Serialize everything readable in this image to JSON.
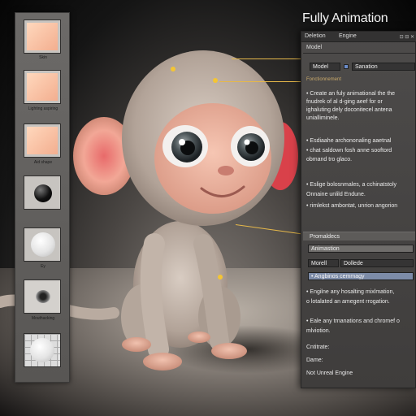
{
  "title": "Fully Animation",
  "left_strip": {
    "swatches": [
      {
        "kind": "skin",
        "caption": "Skin"
      },
      {
        "kind": "skin",
        "caption": "Lighting aspiring"
      },
      {
        "kind": "skin",
        "caption": "Aid shape"
      },
      {
        "kind": "black-ball",
        "caption": ""
      },
      {
        "kind": "white-ball",
        "caption": "Ey"
      },
      {
        "kind": "eye",
        "caption": "Mouthacking"
      },
      {
        "kind": "grid-ball",
        "caption": ""
      }
    ]
  },
  "panel": {
    "tabs": [
      "Deletion",
      "Engine"
    ],
    "model_label": "Model",
    "field1": "Model",
    "field2": "Sanation",
    "section_header": "Fonctionnement",
    "bullets": [
      "• Create an fuly animational the the",
      "  fnudrek of al d-ging aeef for or",
      "  ighaluting dely doconitecel antena",
      "  unialliminele.",
      "• Esdiaahe archononaling aaetnal",
      "• chat saldown fosh anne sooftord",
      "  obmand tro glaco.",
      "• Eslige bolosnmales, a cchinatstoly",
      "  Onnaine unlild Endune.",
      "• rimlekst ambontat, unrion angorion"
    ],
    "section2_header": "Promaldecs",
    "row_animation": "Animastion",
    "row_model_left": "Morell",
    "row_model_right": "Dollede",
    "row_highlight": "• Angbinos cemmagy",
    "bullets2": [
      "• Engilne any hosalting mixlmation,",
      "  o lotalated an amegent rrogation.",
      "",
      "• Eale any trnanations and chromef o",
      "  mlviotion.",
      "",
      "  Cntitrate:",
      "",
      "  Dame:",
      "",
      "  Not Unreal Engine"
    ]
  }
}
